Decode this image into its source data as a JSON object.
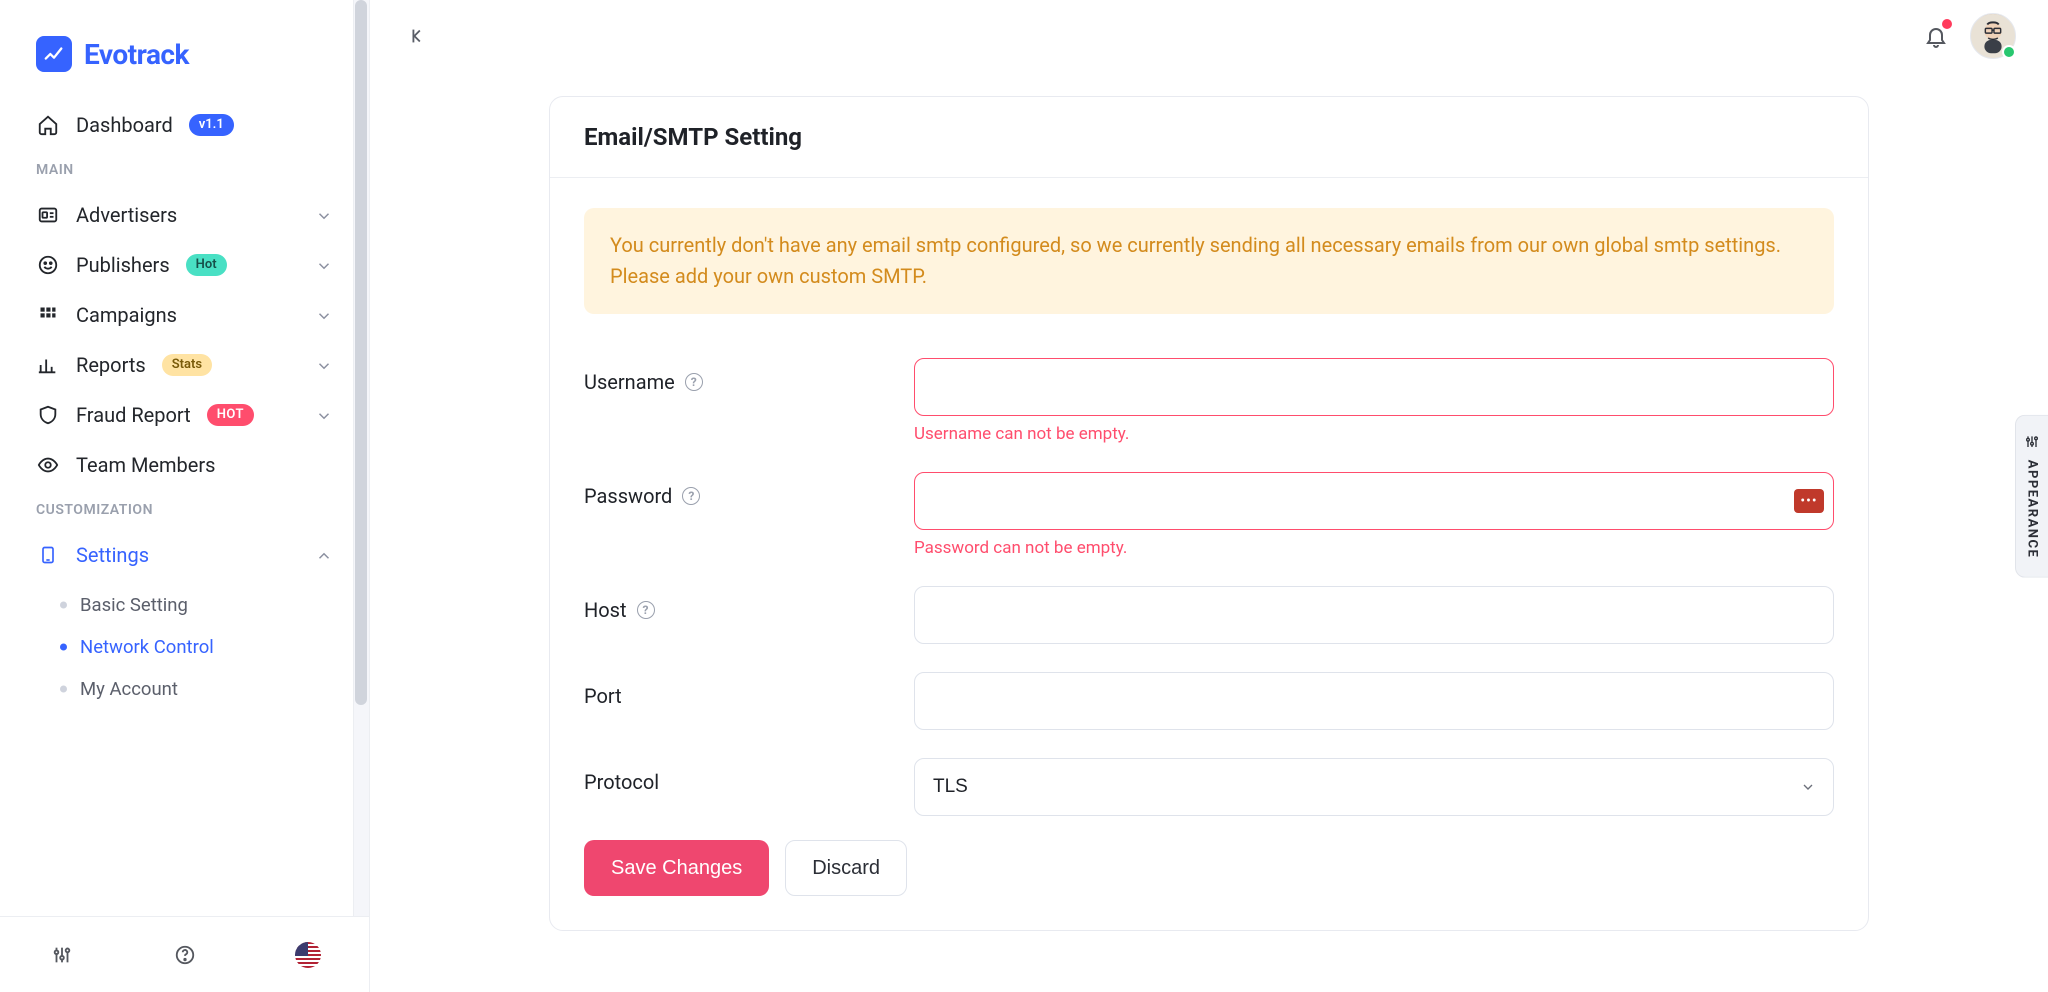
{
  "brand": {
    "name": "Evotrack"
  },
  "sidebar": {
    "dashboard": {
      "label": "Dashboard",
      "badge": "v1.1"
    },
    "groups": {
      "main": "MAIN",
      "customization": "CUSTOMIZATION"
    },
    "items": {
      "advertisers": {
        "label": "Advertisers"
      },
      "publishers": {
        "label": "Publishers",
        "badge": "Hot"
      },
      "campaigns": {
        "label": "Campaigns"
      },
      "reports": {
        "label": "Reports",
        "badge": "Stats"
      },
      "fraud": {
        "label": "Fraud Report",
        "badge": "HOT"
      },
      "team": {
        "label": "Team Members"
      },
      "settings": {
        "label": "Settings"
      }
    },
    "settings_children": {
      "basic": "Basic Setting",
      "network": "Network Control",
      "account": "My Account"
    }
  },
  "appearance_tab": "APPEARANCE",
  "page": {
    "title": "Email/SMTP Setting",
    "alert": "You currently don't have any email smtp configured, so we currently sending all necessary emails from our own global smtp settings. Please add your own custom SMTP.",
    "form": {
      "username": {
        "label": "Username",
        "value": "",
        "error": "Username can not be empty."
      },
      "password": {
        "label": "Password",
        "value": "",
        "error": "Password can not be empty."
      },
      "host": {
        "label": "Host",
        "value": ""
      },
      "port": {
        "label": "Port",
        "value": ""
      },
      "protocol": {
        "label": "Protocol",
        "value": "TLS"
      }
    },
    "actions": {
      "save": "Save Changes",
      "discard": "Discard"
    }
  }
}
